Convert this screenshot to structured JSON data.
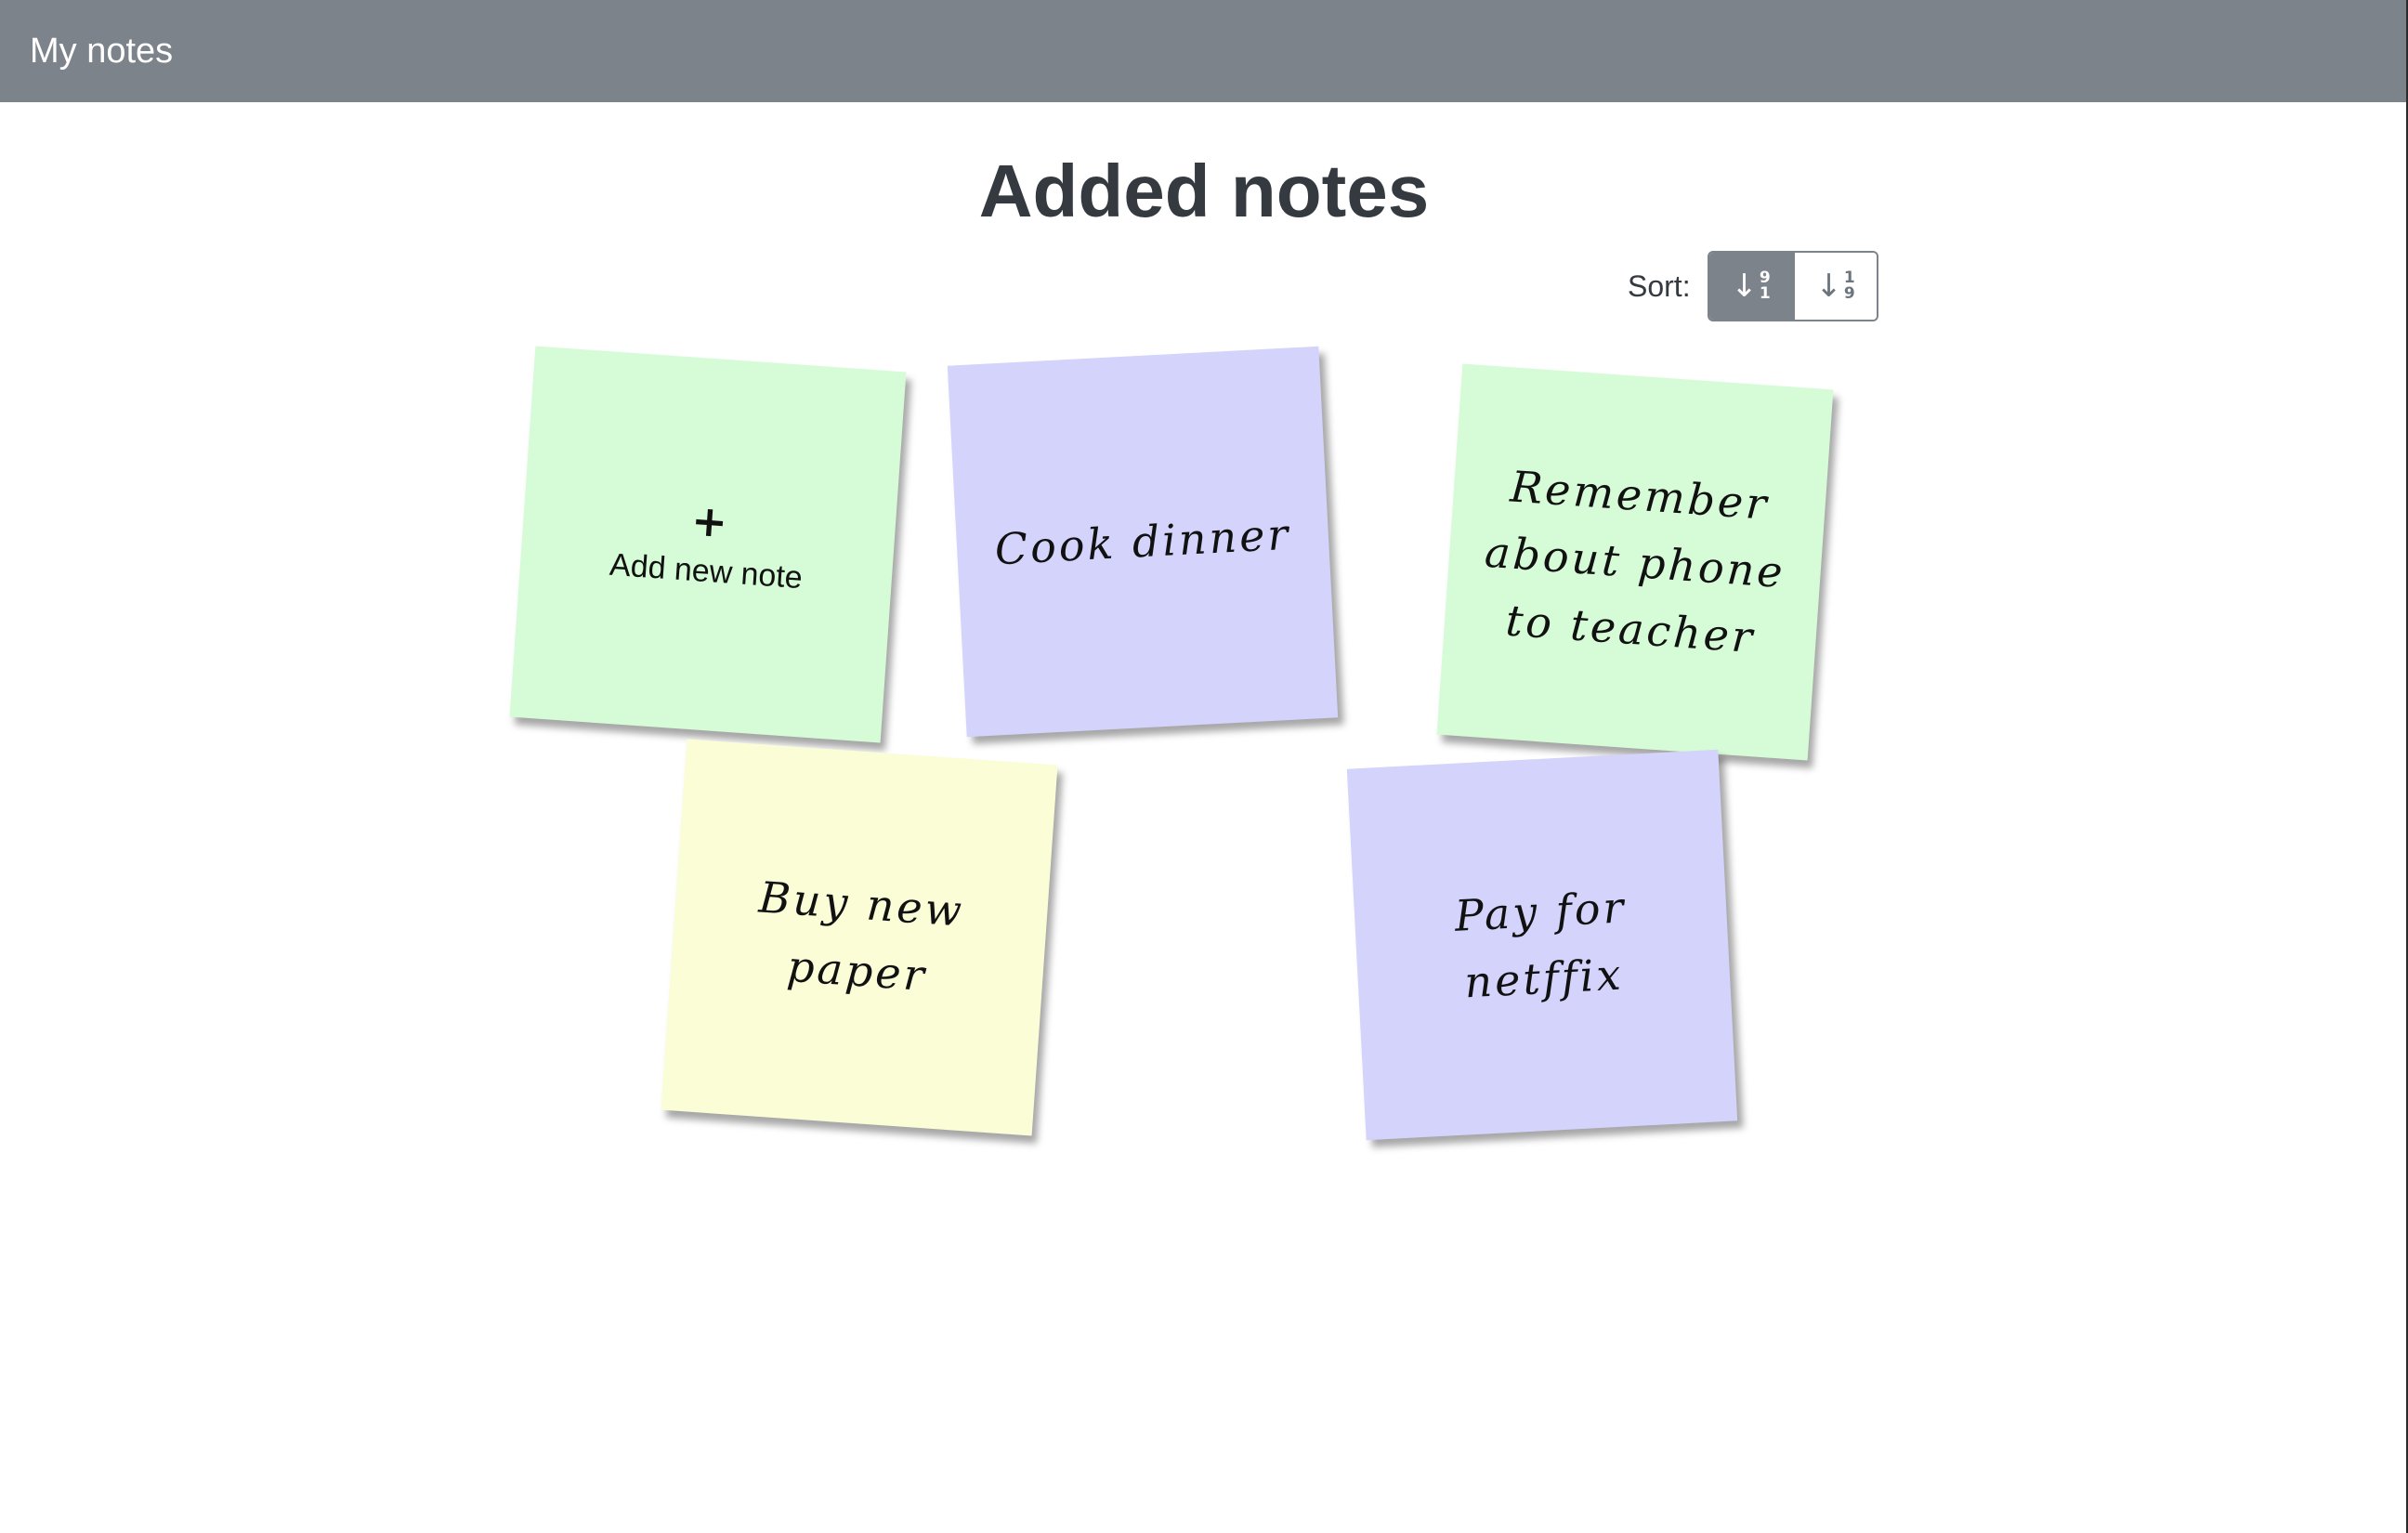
{
  "header": {
    "brand": "My notes"
  },
  "main": {
    "title": "Added notes",
    "sort": {
      "label": "Sort:",
      "buttons": [
        {
          "name": "sort-descending",
          "top_digit": "9",
          "bottom_digit": "1",
          "active": true
        },
        {
          "name": "sort-ascending",
          "top_digit": "1",
          "bottom_digit": "9",
          "active": false
        }
      ]
    },
    "add_note": {
      "plus": "+",
      "label": "Add new note",
      "color": "#d6fbd7"
    },
    "notes": [
      {
        "text": "Cook dinner",
        "color": "#d3d3fb"
      },
      {
        "text": "Remember about phone to teacher",
        "color": "#d6fbd7"
      },
      {
        "text": "Buy new paper",
        "color": "#fbfdd6"
      },
      {
        "text": "Pay for netffix",
        "color": "#d3d3fb"
      }
    ]
  },
  "colors": {
    "navbar": "#7d838b",
    "note_green": "#d6fbd7",
    "note_purple": "#d3d3fb",
    "note_yellow": "#fbfdd6"
  }
}
